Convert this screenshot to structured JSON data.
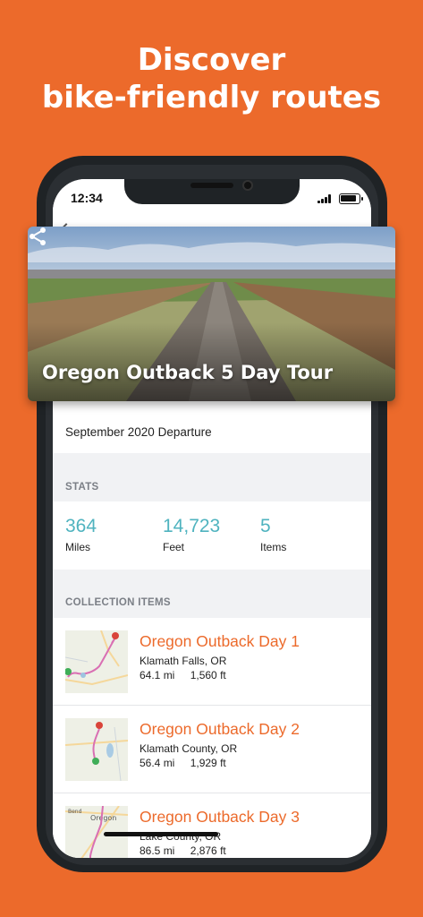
{
  "headline": {
    "line1": "Discover",
    "line2": "bike-friendly routes"
  },
  "status_bar": {
    "time": "12:34"
  },
  "hero": {
    "title": "Oregon Outback 5 Day Tour"
  },
  "departure": "September 2020 Departure",
  "stats": {
    "section_label": "STATS",
    "items": [
      {
        "value": "364",
        "unit": "Miles"
      },
      {
        "value": "14,723",
        "unit": "Feet"
      },
      {
        "value": "5",
        "unit": "Items"
      }
    ]
  },
  "collection": {
    "section_label": "COLLECTION ITEMS",
    "items": [
      {
        "title": "Oregon Outback Day 1",
        "location": "Klamath Falls, OR",
        "distance": "64.1 mi",
        "elevation": "1,560 ft"
      },
      {
        "title": "Oregon Outback Day 2",
        "location": "Klamath County, OR",
        "distance": "56.4 mi",
        "elevation": "1,929 ft"
      },
      {
        "title": "Oregon Outback Day 3",
        "location": "Lake County, OR",
        "distance": "86.5 mi",
        "elevation": "2,876 ft"
      }
    ]
  },
  "map_labels": {
    "item3_town": "Oregon",
    "item3_corner": "Bend"
  },
  "colors": {
    "brand_orange": "#EC6A2B",
    "stat_teal": "#4fb3bf",
    "route_pink": "#d96fb3",
    "start_pin": "#3fae58",
    "end_pin": "#d9443a"
  },
  "icons": [
    "back-chevron-icon",
    "share-icon",
    "signal-icon",
    "battery-icon",
    "map-pin-icon"
  ]
}
